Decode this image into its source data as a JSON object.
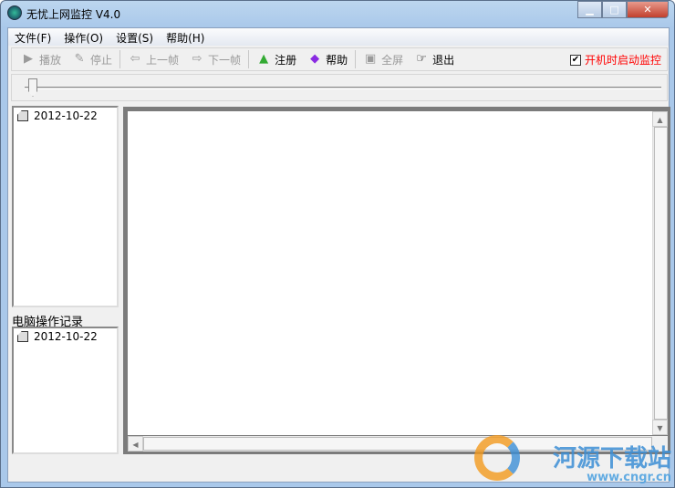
{
  "window": {
    "title": "无忧上网监控 V4.0"
  },
  "menu": [
    "文件(F)",
    "操作(O)",
    "设置(S)",
    "帮助(H)"
  ],
  "toolbar": {
    "play": "播放",
    "stop": "停止",
    "prev": "上一帧",
    "next": "下一帧",
    "register": "注册",
    "help": "帮助",
    "fullscreen": "全屏",
    "exit": "退出",
    "autostart": "开机时启动监控",
    "autostart_checked": true
  },
  "slider": {
    "position": 0
  },
  "tree_top": [
    {
      "label": "2012-10-22"
    }
  ],
  "ops_label": "电脑操作记录",
  "tree_bottom": [
    {
      "label": "2012-10-22"
    }
  ],
  "watermark": {
    "name": "河源下载站",
    "url": "www.cngr.cn"
  }
}
